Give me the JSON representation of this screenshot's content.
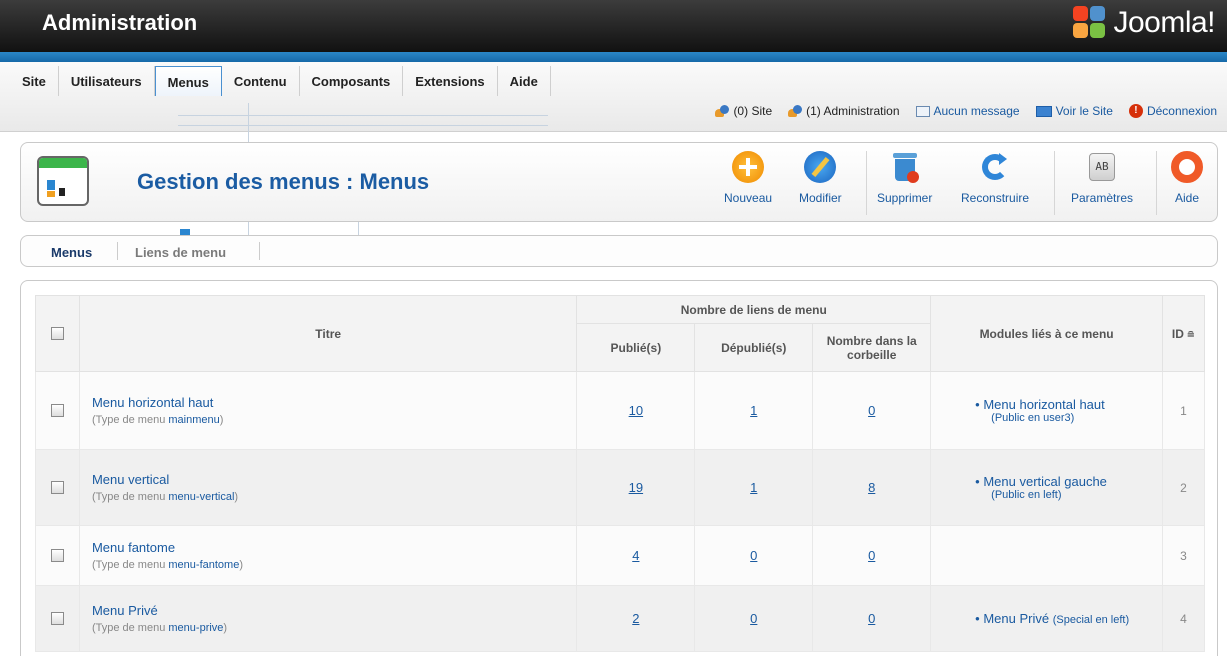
{
  "header": {
    "title": "Administration",
    "logo_text": "Joomla!"
  },
  "menubar": {
    "items": [
      {
        "label": "Site"
      },
      {
        "label": "Utilisateurs"
      },
      {
        "label": "Menus"
      },
      {
        "label": "Contenu"
      },
      {
        "label": "Composants"
      },
      {
        "label": "Extensions"
      },
      {
        "label": "Aide"
      }
    ],
    "active": "Menus"
  },
  "status": {
    "site": "(0) Site",
    "admin": "(1) Administration",
    "messages": "Aucun message",
    "view_site": "Voir le Site",
    "logout": "Déconnexion"
  },
  "toolbar": {
    "page_title": "Gestion des menus : Menus",
    "buttons": [
      {
        "label": "Nouveau",
        "icon": "add-icon"
      },
      {
        "label": "Modifier",
        "icon": "edit-icon"
      },
      {
        "label": "Supprimer",
        "icon": "trash-icon"
      },
      {
        "label": "Reconstruire",
        "icon": "refresh-icon"
      },
      {
        "label": "Paramètres",
        "icon": "options-icon"
      },
      {
        "label": "Aide",
        "icon": "help-icon"
      }
    ]
  },
  "subtabs": {
    "menus": "Menus",
    "liens": "Liens de menu"
  },
  "table": {
    "group_header": "Nombre de liens de menu",
    "col_title": "Titre",
    "col_published": "Publié(s)",
    "col_unpublished": "Dépublié(s)",
    "col_trash": "Nombre dans la corbeille",
    "col_modules": "Modules liés à ce menu",
    "col_id": "ID",
    "type_prefix": "(Type de menu ",
    "type_suffix": ")",
    "rows": [
      {
        "title": "Menu horizontal haut",
        "type": "mainmenu",
        "published": "10",
        "unpublished": "1",
        "trash": "0",
        "module": "Menu horizontal haut",
        "module_pos": "(Public en user3)",
        "id": "1"
      },
      {
        "title": "Menu vertical",
        "type": "menu-vertical",
        "published": "19",
        "unpublished": "1",
        "trash": "8",
        "module": "Menu vertical gauche",
        "module_pos": "(Public en left)",
        "id": "2"
      },
      {
        "title": "Menu fantome",
        "type": "menu-fantome",
        "published": "4",
        "unpublished": "0",
        "trash": "0",
        "module": "",
        "module_pos": "",
        "id": "3"
      },
      {
        "title": "Menu Privé",
        "type": "menu-prive",
        "published": "2",
        "unpublished": "0",
        "trash": "0",
        "module": "Menu Privé",
        "module_pos": "(Special en left)",
        "id": "4"
      }
    ]
  },
  "colors": {
    "brand_blue": "#1b5ca3",
    "link": "#1a5aa0",
    "header_bg": "#1f1f1f",
    "bar_blue": "#1e78bd"
  }
}
